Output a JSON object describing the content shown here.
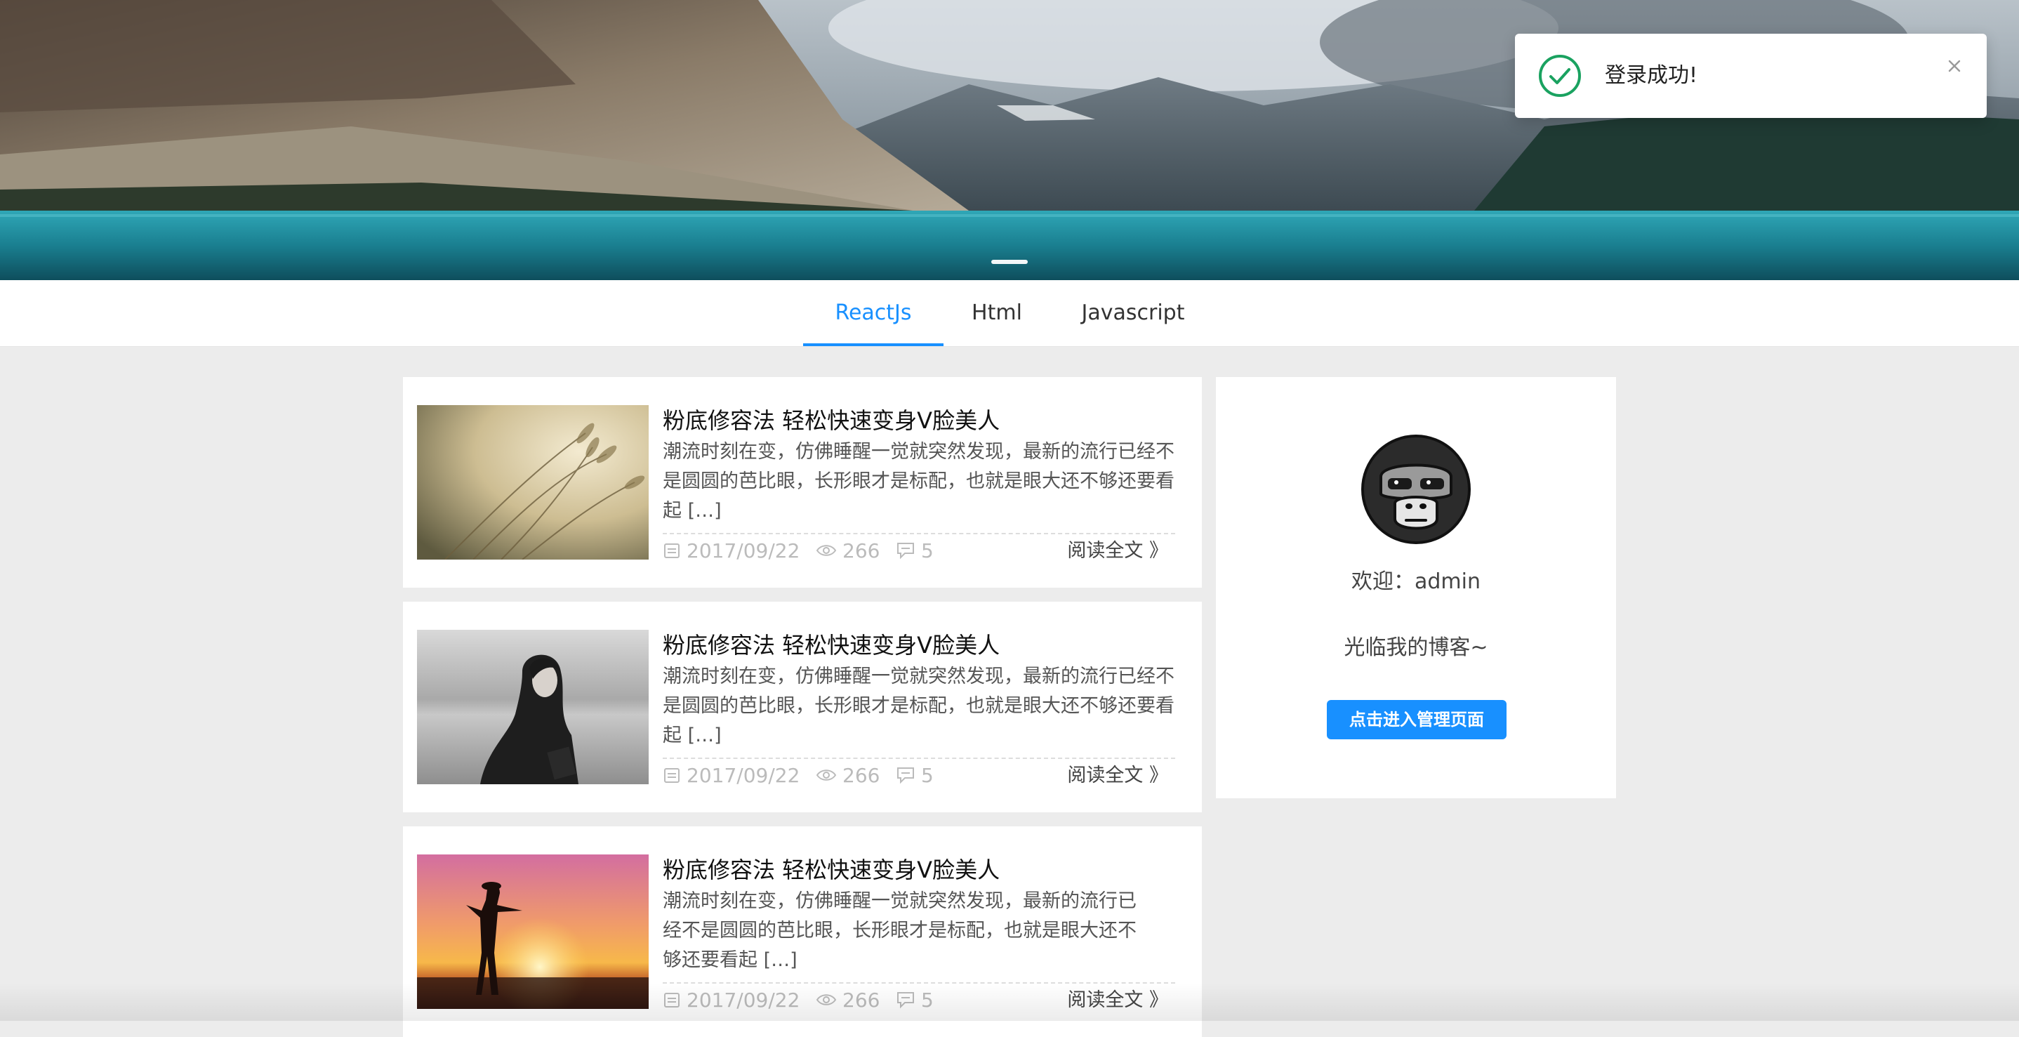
{
  "banner": {
    "image": "mountain-lake-landscape",
    "active_slide": 1
  },
  "tabs": [
    {
      "label": "ReactJs",
      "active": true
    },
    {
      "label": "Html",
      "active": false
    },
    {
      "label": "Javascript",
      "active": false
    }
  ],
  "articles": [
    {
      "title": "粉底修容法 轻松快速变身V脸美人",
      "desc": "潮流时刻在变，仿佛睡醒一觉就突然发现，最新的流行已经不是圆圆的芭比眼，长形眼才是标配，也就是眼大还不够还要看起 […]",
      "date": "2017/09/22",
      "views": "266",
      "comments": "5",
      "read_more": "阅读全文 》",
      "thumb": "wheat-grass-photo"
    },
    {
      "title": "粉底修容法 轻松快速变身V脸美人",
      "desc": "潮流时刻在变，仿佛睡醒一觉就突然发现，最新的流行已经不是圆圆的芭比眼，长形眼才是标配，也就是眼大还不够还要看起 […]",
      "date": "2017/09/22",
      "views": "266",
      "comments": "5",
      "read_more": "阅读全文 》",
      "thumb": "woman-bw-photo"
    },
    {
      "title": "粉底修容法 轻松快速变身V脸美人",
      "desc": "潮流时刻在变，仿佛睡醒一觉就突然发现，最新的流行已经不是圆圆的芭比眼，长形眼才是标配，也就是眼大还不够还要看起 […]",
      "date": "2017/09/22",
      "views": "266",
      "comments": "5",
      "read_more": "阅读全文 》",
      "thumb": "sunset-silhouette-photo"
    }
  ],
  "sidebar": {
    "welcome": "欢迎：admin",
    "subtitle": "光临我的博客~",
    "button": "点击进入管理页面"
  },
  "notification": {
    "message": "登录成功!"
  },
  "colors": {
    "accent": "#1890ff",
    "success": "#1aa260",
    "page_bg": "#ececec"
  }
}
